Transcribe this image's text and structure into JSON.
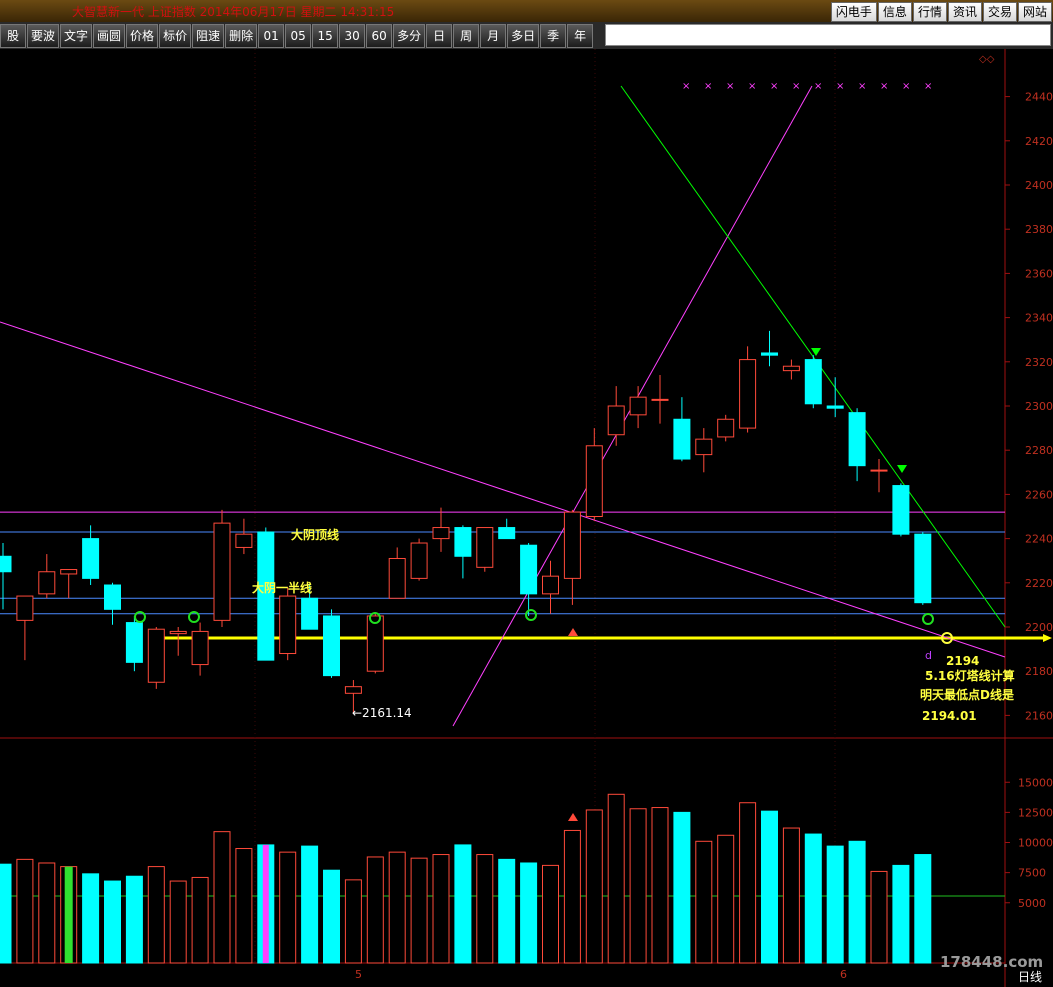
{
  "title_bar": {
    "title": "大智慧新一代 上证指数 2014年06月17日 星期二 14:31:15",
    "menu": [
      "闪电手",
      "信息",
      "行情",
      "资讯",
      "交易",
      "网站"
    ]
  },
  "toolbar": {
    "tools": [
      "股",
      "要波",
      "文字",
      "画圆",
      "价格",
      "标价",
      "阻速",
      "删除",
      "01",
      "05",
      "15",
      "30",
      "60",
      "多分",
      "日",
      "周",
      "月",
      "多日",
      "季",
      "年"
    ]
  },
  "price_axis": [
    "2440",
    "2420",
    "2400",
    "2380",
    "2360",
    "2340",
    "2320",
    "2300",
    "2280",
    "2260",
    "2240",
    "2220",
    "2200",
    "2180",
    "2160"
  ],
  "volume_axis": [
    "15000",
    "12500",
    "10000",
    "7500",
    "5000"
  ],
  "dates": [
    "5",
    "6"
  ],
  "annotations": {
    "top_line": "大阴顶线",
    "half_line": "大阴一半线",
    "low_label": "←2161.14",
    "d_mark": "d",
    "price_2194": "2194",
    "note1": "5.16灯塔线计算",
    "note2": "明天最低点D线是",
    "note3": "2194.01"
  },
  "watermark": "178448.com",
  "period": "日线",
  "colors": {
    "up": "#ff4a3a",
    "down": "#00ffff",
    "support": "#ffff00",
    "trend": "#ff40ff",
    "fan": "#00ff00"
  },
  "chart_data": {
    "type": "candlestick",
    "ylim": [
      2150,
      2450
    ],
    "volume_ylim": [
      0,
      17000
    ],
    "candles": [
      {
        "o": 2232,
        "h": 2238,
        "l": 2208,
        "c": 2225
      },
      {
        "o": 2203,
        "h": 2214,
        "l": 2185,
        "c": 2214
      },
      {
        "o": 2215,
        "h": 2233,
        "l": 2213,
        "c": 2225
      },
      {
        "o": 2224,
        "h": 2226,
        "l": 2213,
        "c": 2226
      },
      {
        "o": 2240,
        "h": 2246,
        "l": 2219,
        "c": 2222
      },
      {
        "o": 2219,
        "h": 2220,
        "l": 2201,
        "c": 2208
      },
      {
        "o": 2202,
        "h": 2205,
        "l": 2180,
        "c": 2184
      },
      {
        "o": 2175,
        "h": 2200,
        "l": 2172,
        "c": 2199
      },
      {
        "o": 2197,
        "h": 2200,
        "l": 2187,
        "c": 2198
      },
      {
        "o": 2183,
        "h": 2202,
        "l": 2178,
        "c": 2198
      },
      {
        "o": 2203,
        "h": 2253,
        "l": 2200,
        "c": 2247
      },
      {
        "o": 2236,
        "h": 2249,
        "l": 2233,
        "c": 2242
      },
      {
        "o": 2243,
        "h": 2245,
        "l": 2185,
        "c": 2185
      },
      {
        "o": 2188,
        "h": 2218,
        "l": 2185,
        "c": 2214
      },
      {
        "o": 2213,
        "h": 2219,
        "l": 2199,
        "c": 2199
      },
      {
        "o": 2205,
        "h": 2208,
        "l": 2177,
        "c": 2178
      },
      {
        "o": 2170,
        "h": 2176,
        "l": 2161,
        "c": 2173
      },
      {
        "o": 2180,
        "h": 2206,
        "l": 2179,
        "c": 2205
      },
      {
        "o": 2213,
        "h": 2236,
        "l": 2213,
        "c": 2231
      },
      {
        "o": 2222,
        "h": 2240,
        "l": 2221,
        "c": 2238
      },
      {
        "o": 2240,
        "h": 2254,
        "l": 2234,
        "c": 2245
      },
      {
        "o": 2245,
        "h": 2246,
        "l": 2222,
        "c": 2232
      },
      {
        "o": 2227,
        "h": 2245,
        "l": 2225,
        "c": 2245
      },
      {
        "o": 2245,
        "h": 2249,
        "l": 2240,
        "c": 2240
      },
      {
        "o": 2237,
        "h": 2238,
        "l": 2205,
        "c": 2215
      },
      {
        "o": 2215,
        "h": 2230,
        "l": 2206,
        "c": 2223
      },
      {
        "o": 2222,
        "h": 2253,
        "l": 2210,
        "c": 2252
      },
      {
        "o": 2250,
        "h": 2290,
        "l": 2248,
        "c": 2282
      },
      {
        "o": 2287,
        "h": 2309,
        "l": 2282,
        "c": 2300
      },
      {
        "o": 2296,
        "h": 2309,
        "l": 2290,
        "c": 2304
      },
      {
        "o": 2303,
        "h": 2314,
        "l": 2292,
        "c": 2303
      },
      {
        "o": 2294,
        "h": 2304,
        "l": 2275,
        "c": 2276
      },
      {
        "o": 2278,
        "h": 2290,
        "l": 2270,
        "c": 2285
      },
      {
        "o": 2286,
        "h": 2296,
        "l": 2284,
        "c": 2294
      },
      {
        "o": 2290,
        "h": 2327,
        "l": 2288,
        "c": 2321
      },
      {
        "o": 2324,
        "h": 2334,
        "l": 2318,
        "c": 2323
      },
      {
        "o": 2316,
        "h": 2321,
        "l": 2312,
        "c": 2318
      },
      {
        "o": 2321,
        "h": 2323,
        "l": 2299,
        "c": 2301
      },
      {
        "o": 2300,
        "h": 2313,
        "l": 2295,
        "c": 2299
      },
      {
        "o": 2297,
        "h": 2299,
        "l": 2266,
        "c": 2273
      },
      {
        "o": 2271,
        "h": 2276,
        "l": 2261,
        "c": 2271
      },
      {
        "o": 2264,
        "h": 2265,
        "l": 2241,
        "c": 2242
      },
      {
        "o": 2242,
        "h": 2243,
        "l": 2210,
        "c": 2211
      }
    ],
    "volumes": [
      8200,
      8600,
      8300,
      8000,
      7400,
      6800,
      7200,
      8000,
      6800,
      7100,
      10900,
      9500,
      9800,
      9200,
      9700,
      7700,
      6900,
      8800,
      9200,
      8700,
      9000,
      9800,
      9000,
      8600,
      8300,
      8100,
      11000,
      12700,
      14000,
      12800,
      12900,
      12500,
      10100,
      10600,
      13300,
      12600,
      11200,
      10700,
      9700,
      10100,
      7600,
      8100,
      9000
    ],
    "levels": {
      "top_line": 2252,
      "blue1": 2243,
      "half_line": 2213,
      "blue2": 2206,
      "support": 2195
    }
  }
}
